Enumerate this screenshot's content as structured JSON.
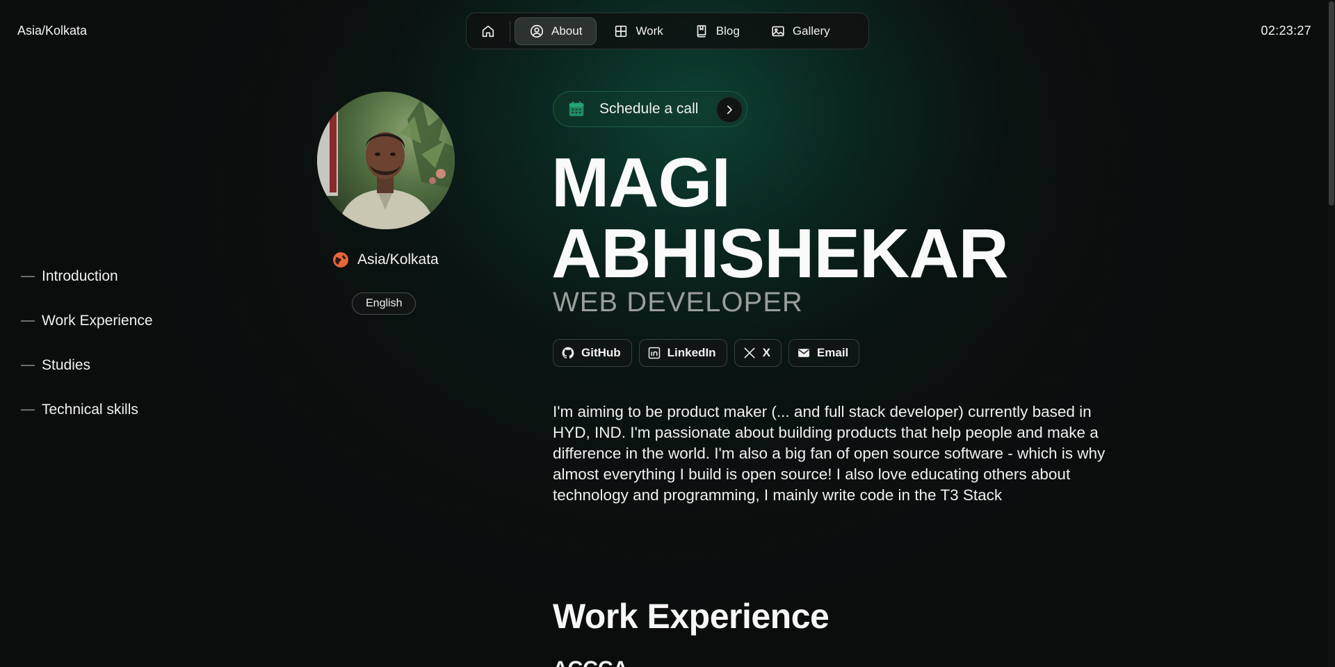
{
  "header": {
    "timezone": "Asia/Kolkata",
    "time": "02:23:27"
  },
  "nav": {
    "items": [
      {
        "label": "",
        "icon": "home-icon"
      },
      {
        "label": "About",
        "icon": "user-circle-icon",
        "active": true
      },
      {
        "label": "Work",
        "icon": "grid-icon"
      },
      {
        "label": "Blog",
        "icon": "book-icon"
      },
      {
        "label": "Gallery",
        "icon": "image-icon"
      }
    ]
  },
  "toc": {
    "items": [
      {
        "label": "Introduction"
      },
      {
        "label": "Work Experience"
      },
      {
        "label": "Studies"
      },
      {
        "label": "Technical skills"
      }
    ]
  },
  "profile": {
    "location": "Asia/Kolkata",
    "language": "English"
  },
  "schedule": {
    "label": "Schedule a call"
  },
  "hero": {
    "name_line1": "MAGI",
    "name_line2": "ABHISHEKAR",
    "role": "WEB DEVELOPER"
  },
  "socials": [
    {
      "label": "GitHub",
      "icon": "github-icon"
    },
    {
      "label": "LinkedIn",
      "icon": "linkedin-icon"
    },
    {
      "label": "X",
      "icon": "x-icon"
    },
    {
      "label": "Email",
      "icon": "email-icon"
    }
  ],
  "bio": "I'm aiming to be product maker (... and full stack developer) currently based in HYD, IND. I'm passionate about building products that help people and make a difference in the world. I'm also a big fan of open source software - which is why almost everything I build is open source! I also love educating others about technology and programming, I mainly write code in the T3 Stack",
  "work": {
    "title": "Work Experience",
    "first_company": "ACCCA"
  },
  "colors": {
    "accent": "#1f8a63",
    "background": "#0b0c0c",
    "glow": "#0e5c48",
    "location_icon": "#e8643a"
  }
}
